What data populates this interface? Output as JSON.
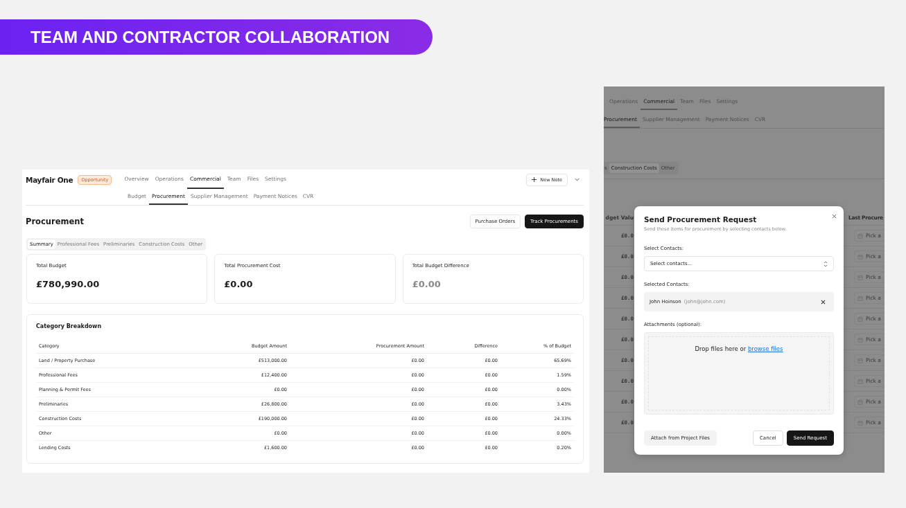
{
  "banner": {
    "title": "TEAM AND CONTRACTOR COLLABORATION"
  },
  "main_screen": {
    "project": "Mayfair One",
    "status_badge": "Opportunity",
    "nav_tabs": [
      {
        "label": "Overview",
        "selected": false
      },
      {
        "label": "Operations",
        "selected": false
      },
      {
        "label": "Commercial",
        "selected": true
      },
      {
        "label": "Team",
        "selected": false
      },
      {
        "label": "Files",
        "selected": false
      },
      {
        "label": "Settings",
        "selected": false
      }
    ],
    "new_note_button": "New Note",
    "sub_tabs": [
      {
        "label": "Budget",
        "selected": false
      },
      {
        "label": "Procurement",
        "selected": true
      },
      {
        "label": "Supplier Management",
        "selected": false
      },
      {
        "label": "Payment Notices",
        "selected": false
      },
      {
        "label": "CVR",
        "selected": false
      }
    ],
    "page_title": "Procurement",
    "actions": [
      {
        "label": "Purchase Orders",
        "kind": "secondary"
      },
      {
        "label": "Track Procurements",
        "kind": "primary"
      }
    ],
    "filter_tabs": [
      {
        "label": "Summary",
        "selected": true
      },
      {
        "label": "Professional Fees",
        "selected": false
      },
      {
        "label": "Preliminaries",
        "selected": false
      },
      {
        "label": "Construction Costs",
        "selected": false
      },
      {
        "label": "Other",
        "selected": false
      }
    ],
    "summary_cards": [
      {
        "label": "Total Budget",
        "value": "£780,990.00",
        "muted": false
      },
      {
        "label": "Total Procurement Cost",
        "value": "£0.00",
        "muted": false
      },
      {
        "label": "Total Budget Difference",
        "value": "£0.00",
        "muted": true
      }
    ],
    "breakdown": {
      "title": "Category Breakdown",
      "columns": [
        "Category",
        "Budget Amount",
        "Procurement Amount",
        "Difference",
        "% of Budget"
      ],
      "rows": [
        [
          "Land / Property Purchase",
          "£513,000.00",
          "£0.00",
          "£0.00",
          "65.69%"
        ],
        [
          "Professional Fees",
          "£12,400.00",
          "£0.00",
          "£0.00",
          "1.59%"
        ],
        [
          "Planning & Permit Fees",
          "£0.00",
          "£0.00",
          "£0.00",
          "0.00%"
        ],
        [
          "Preliminaries",
          "£26,800.00",
          "£0.00",
          "£0.00",
          "3.43%"
        ],
        [
          "Construction Costs",
          "£190,000.00",
          "£0.00",
          "£0.00",
          "24.33%"
        ],
        [
          "Other",
          "£0.00",
          "£0.00",
          "£0.00",
          "0.00%"
        ],
        [
          "Lending Costs",
          "£1,600.00",
          "£0.00",
          "£0.00",
          "0.20%"
        ]
      ]
    }
  },
  "dialog_screen": {
    "nav_tabs": [
      {
        "label": "Operations",
        "selected": false
      },
      {
        "label": "Commercial",
        "selected": true
      },
      {
        "label": "Team",
        "selected": false
      },
      {
        "label": "Files",
        "selected": false
      },
      {
        "label": "Settings",
        "selected": false
      }
    ],
    "sub_tabs": [
      {
        "label": "Procurement",
        "selected": true
      },
      {
        "label": "Supplier Management",
        "selected": false
      },
      {
        "label": "Payment Notices",
        "selected": false
      },
      {
        "label": "CVR",
        "selected": false
      }
    ],
    "filter_tabs": [
      {
        "label": "s",
        "selected": false
      },
      {
        "label": "Construction Costs",
        "selected": true
      },
      {
        "label": "Other",
        "selected": false
      }
    ],
    "table": {
      "columns": [
        "dget Valu",
        "Last Procure"
      ],
      "rows": [
        {
          "column_1": "£0.0",
          "column_2": "Pick a"
        },
        {
          "column_1": "£0.0",
          "column_2": "Pick a"
        },
        {
          "column_1": "£0.0",
          "column_2": "Pick a"
        },
        {
          "column_1": "£0.0",
          "column_2": "Pick a"
        },
        {
          "column_1": "£0.0",
          "column_2": "Pick a"
        },
        {
          "column_1": "£0.0",
          "column_2": "Pick a"
        },
        {
          "column_1": "£0.0",
          "column_2": "Pick a"
        },
        {
          "column_1": "£0.0",
          "column_2": "Pick a"
        },
        {
          "column_1": "£0.0",
          "column_2": "Pick a"
        },
        {
          "column_1": "£0.0",
          "column_2": "Pick a"
        }
      ]
    },
    "dialog": {
      "title": "Send Procurement Request",
      "subtitle": "Send these items for procurement by selecting contacts below.",
      "select_label": "Select Contacts:",
      "select_placeholder": "Select contacts...",
      "selected_label": "Selected Contacts:",
      "contacts": [
        {
          "name": "John Hoinson",
          "email": "(john@john.com)"
        }
      ],
      "attachments_label": "Attachments (optional):",
      "drop_text": "Drop files here or",
      "drop_link": "browse files",
      "buttons": [
        {
          "label": "Attach from Project Files",
          "kind": "secondary"
        },
        {
          "label": "Cancel",
          "kind": "outline"
        },
        {
          "label": "Send Request",
          "kind": "primary"
        }
      ]
    }
  }
}
